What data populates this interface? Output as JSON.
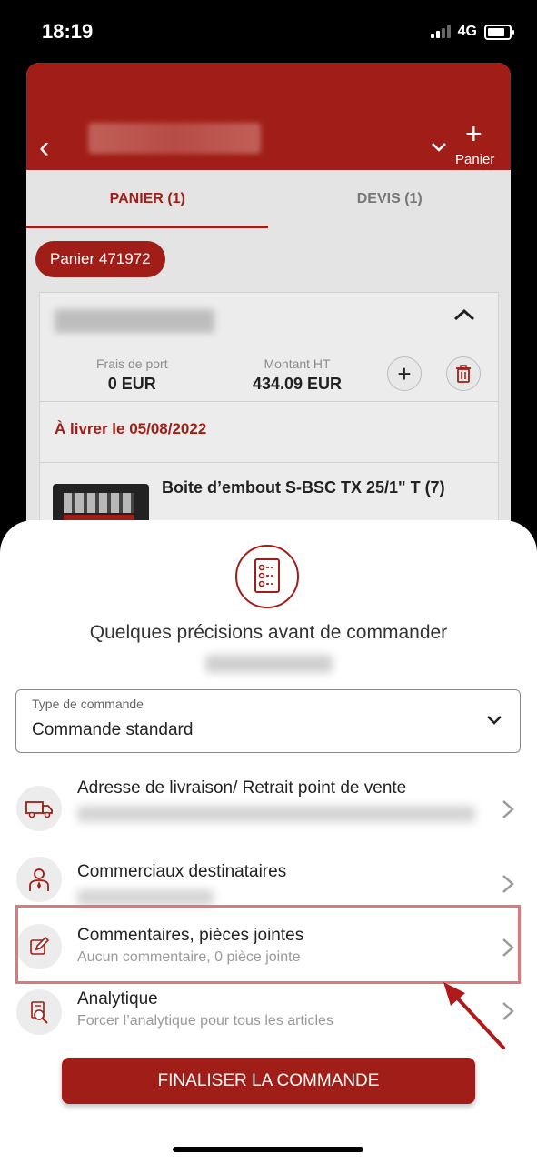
{
  "status_bar": {
    "time": "18:19",
    "network": "4G"
  },
  "header": {
    "add_label": "Panier"
  },
  "tabs": [
    {
      "label": "PANIER (1)",
      "active": true
    },
    {
      "label": "DEVIS (1)",
      "active": false
    }
  ],
  "cart": {
    "chip": "Panier 471972",
    "shipping_label": "Frais de port",
    "shipping_value": "0 EUR",
    "amount_label": "Montant HT",
    "amount_value": "434.09 EUR",
    "delivery": "À livrer le 05/08/2022",
    "product_name": "Boite d’embout S-BSC TX 25/1\" T (7)"
  },
  "sheet": {
    "title": "Quelques précisions avant de commander",
    "order_type": {
      "label": "Type de commande",
      "value": "Commande standard"
    },
    "rows": [
      {
        "title": "Adresse de livraison/ Retrait point de vente",
        "subtitle": "",
        "icon": "truck-icon"
      },
      {
        "title": "Commerciaux destinataires",
        "subtitle": "",
        "icon": "salesperson-icon"
      },
      {
        "title": "Commentaires, pièces jointes",
        "subtitle": "Aucun commentaire, 0 pièce jointe",
        "icon": "pencil-edit-icon"
      },
      {
        "title": "Analytique",
        "subtitle": "Forcer l’analytique pour tous les articles",
        "icon": "analytics-search-icon"
      }
    ],
    "finalize_label": "FINALISER LA COMMANDE"
  },
  "colors": {
    "brand": "#a01e17",
    "highlight": "#e07878"
  }
}
